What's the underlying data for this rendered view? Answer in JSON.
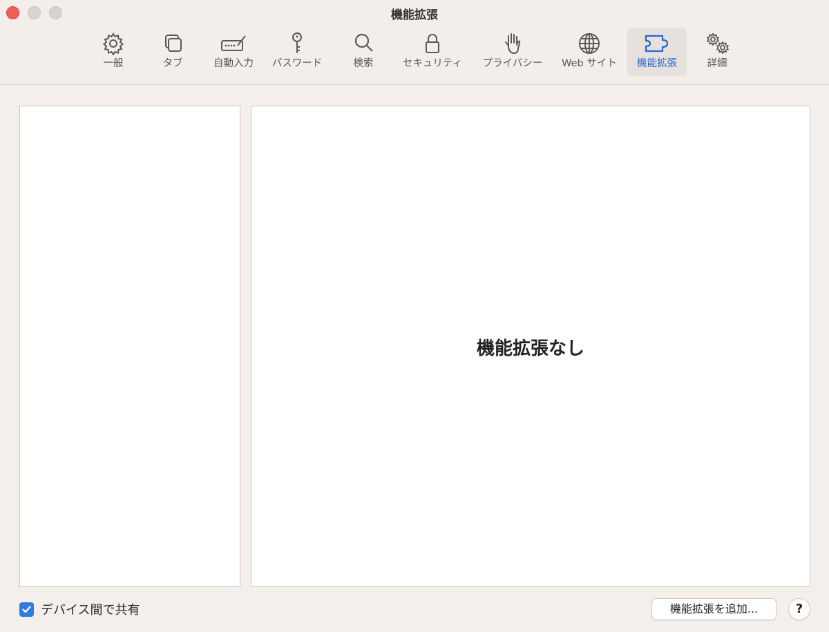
{
  "window": {
    "title": "機能拡張"
  },
  "toolbar": {
    "items": [
      {
        "label": "一般",
        "icon": "gear-icon"
      },
      {
        "label": "タブ",
        "icon": "tabs-icon"
      },
      {
        "label": "自動入力",
        "icon": "autofill-icon"
      },
      {
        "label": "パスワード",
        "icon": "key-icon"
      },
      {
        "label": "検索",
        "icon": "search-icon"
      },
      {
        "label": "セキュリティ",
        "icon": "lock-icon"
      },
      {
        "label": "プライバシー",
        "icon": "hand-icon"
      },
      {
        "label": "Web サイト",
        "icon": "globe-icon"
      },
      {
        "label": "機能拡張",
        "icon": "puzzle-icon",
        "selected": true
      },
      {
        "label": "詳細",
        "icon": "gears-icon"
      }
    ]
  },
  "main": {
    "empty_message": "機能拡張なし"
  },
  "footer": {
    "share_label": "デバイス間で共有",
    "share_checked": true,
    "add_button_label": "機能拡張を追加...",
    "help_label": "?"
  },
  "colors": {
    "accent": "#2167d8",
    "checkbox": "#2e7be4",
    "close": "#ee5f57"
  }
}
